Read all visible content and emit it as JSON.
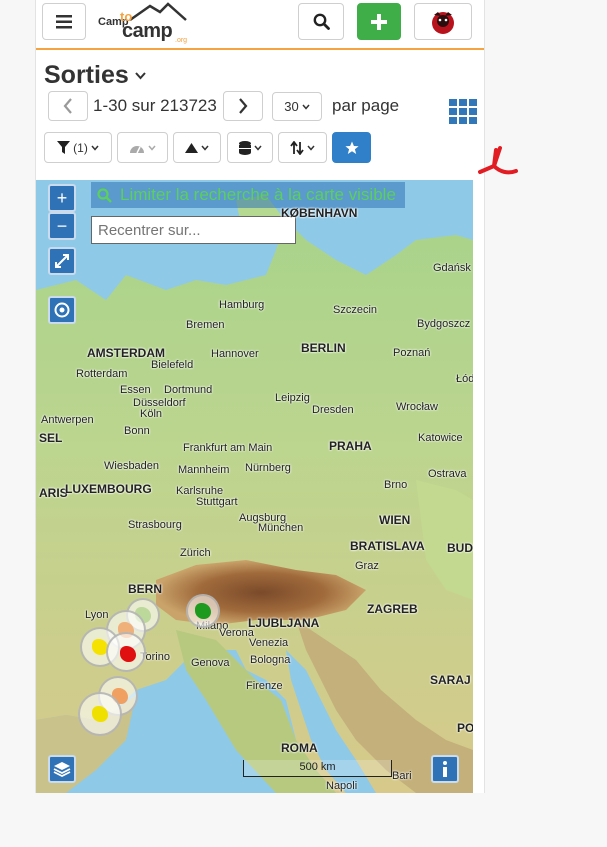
{
  "header": {
    "menu_icon": "hamburger-icon",
    "logo": {
      "part1": "Camp",
      "part2": "to",
      "part3": "camp",
      "part4": ".org"
    },
    "search_icon": "search-icon",
    "add_icon": "plus-icon",
    "avatar_icon": "user-avatar-icon"
  },
  "page": {
    "title": "Sorties",
    "title_chevron": "chevron-down-icon"
  },
  "pagination": {
    "range_text": "1-30 sur 213723",
    "page_size": "30",
    "per_page_label": "par page"
  },
  "filters": {
    "filter_count": "(1)"
  },
  "map": {
    "search_toggle_label": "Limiter la recherche à la carte visible",
    "recenter_placeholder": "Recentrer sur...",
    "scale_label": "500 km",
    "cities": [
      {
        "name": "KØBENHAVN",
        "cap": true
      },
      {
        "name": "Gdańsk",
        "cap": false
      },
      {
        "name": "Hamburg",
        "cap": false
      },
      {
        "name": "Szczecin",
        "cap": false
      },
      {
        "name": "Bremen",
        "cap": false
      },
      {
        "name": "Bydgoszcz",
        "cap": false
      },
      {
        "name": "AMSTERDAM",
        "cap": true
      },
      {
        "name": "Hannover",
        "cap": false
      },
      {
        "name": "BERLIN",
        "cap": true
      },
      {
        "name": "Poznań",
        "cap": false
      },
      {
        "name": "Bielefeld",
        "cap": false
      },
      {
        "name": "Rotterdam",
        "cap": false
      },
      {
        "name": "Łódź",
        "cap": false
      },
      {
        "name": "Essen",
        "cap": false
      },
      {
        "name": "Dortmund",
        "cap": false
      },
      {
        "name": "Düsseldorf",
        "cap": false
      },
      {
        "name": "Leipzig",
        "cap": false
      },
      {
        "name": "Köln",
        "cap": false
      },
      {
        "name": "Dresden",
        "cap": false
      },
      {
        "name": "Wrocław",
        "cap": false
      },
      {
        "name": "Antwerpen",
        "cap": false
      },
      {
        "name": "Bonn",
        "cap": false
      },
      {
        "name": "SEL",
        "cap": true
      },
      {
        "name": "Frankfurt am Main",
        "cap": false
      },
      {
        "name": "PRAHA",
        "cap": true
      },
      {
        "name": "Katowice",
        "cap": false
      },
      {
        "name": "Wiesbaden",
        "cap": false
      },
      {
        "name": "Mannheim",
        "cap": false
      },
      {
        "name": "Nürnberg",
        "cap": false
      },
      {
        "name": "Ostrava",
        "cap": false
      },
      {
        "name": "ARIS",
        "cap": true
      },
      {
        "name": "LUXEMBOURG",
        "cap": true
      },
      {
        "name": "Karlsruhe",
        "cap": false
      },
      {
        "name": "Brno",
        "cap": false
      },
      {
        "name": "Stuttgart",
        "cap": false
      },
      {
        "name": "Strasbourg",
        "cap": false
      },
      {
        "name": "Augsburg",
        "cap": false
      },
      {
        "name": "München",
        "cap": false
      },
      {
        "name": "WIEN",
        "cap": true
      },
      {
        "name": "BRATISLAVA",
        "cap": true
      },
      {
        "name": "BUD",
        "cap": true
      },
      {
        "name": "Zürich",
        "cap": false
      },
      {
        "name": "Graz",
        "cap": false
      },
      {
        "name": "BERN",
        "cap": true
      },
      {
        "name": "ZAGREB",
        "cap": true
      },
      {
        "name": "Lyon",
        "cap": false
      },
      {
        "name": "Milano",
        "cap": false
      },
      {
        "name": "LJUBLJANA",
        "cap": true
      },
      {
        "name": "Verona",
        "cap": false
      },
      {
        "name": "Venezia",
        "cap": false
      },
      {
        "name": "Torino",
        "cap": false
      },
      {
        "name": "Bologna",
        "cap": false
      },
      {
        "name": "Genova",
        "cap": false
      },
      {
        "name": "SARAJ",
        "cap": true
      },
      {
        "name": "Firenze",
        "cap": false
      },
      {
        "name": "POD",
        "cap": true
      },
      {
        "name": "ROMA",
        "cap": true
      },
      {
        "name": "Bari",
        "cap": false
      },
      {
        "name": "Napoli",
        "cap": false
      }
    ]
  },
  "colors": {
    "accent_orange": "#f4a340",
    "add_green": "#3fae49",
    "brand_blue": "#2f72b6",
    "star_blue": "#2f80c9"
  }
}
